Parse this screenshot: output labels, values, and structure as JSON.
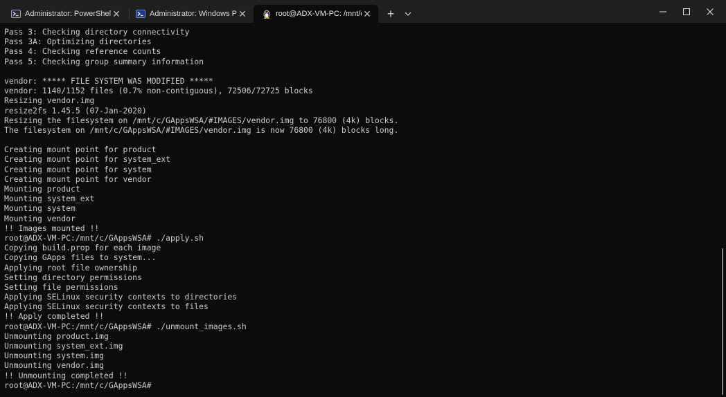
{
  "window": {
    "tabs": [
      {
        "label": "Administrator: PowerShell",
        "icon": "powershell-icon",
        "active": false
      },
      {
        "label": "Administrator: Windows PowerShell",
        "icon": "powershell-icon",
        "active": false
      },
      {
        "label": "root@ADX-VM-PC: /mnt/c/GAppsWSA",
        "icon": "linux-penguin-icon",
        "active": true
      }
    ],
    "new_tab_glyph": "+",
    "dropdown_glyph": "⌵",
    "controls": {
      "minimize": "–",
      "maximize": "☐",
      "close": "✕"
    }
  },
  "terminal": {
    "lines": [
      "Pass 3: Checking directory connectivity",
      "Pass 3A: Optimizing directories",
      "Pass 4: Checking reference counts",
      "Pass 5: Checking group summary information",
      "",
      "vendor: ***** FILE SYSTEM WAS MODIFIED *****",
      "vendor: 1140/1152 files (0.7% non-contiguous), 72506/72725 blocks",
      "Resizing vendor.img",
      "resize2fs 1.45.5 (07-Jan-2020)",
      "Resizing the filesystem on /mnt/c/GAppsWSA/#IMAGES/vendor.img to 76800 (4k) blocks.",
      "The filesystem on /mnt/c/GAppsWSA/#IMAGES/vendor.img is now 76800 (4k) blocks long.",
      "",
      "Creating mount point for product",
      "Creating mount point for system_ext",
      "Creating mount point for system",
      "Creating mount point for vendor",
      "Mounting product",
      "Mounting system_ext",
      "Mounting system",
      "Mounting vendor",
      "!! Images mounted !!",
      "root@ADX-VM-PC:/mnt/c/GAppsWSA# ./apply.sh",
      "Copying build.prop for each image",
      "Copying GApps files to system...",
      "Applying root file ownership",
      "Setting directory permissions",
      "Setting file permissions",
      "Applying SELinux security contexts to directories",
      "Applying SELinux security contexts to files",
      "!! Apply completed !!",
      "root@ADX-VM-PC:/mnt/c/GAppsWSA# ./unmount_images.sh",
      "Unmounting product.img",
      "Unmounting system_ext.img",
      "Unmounting system.img",
      "Unmounting vendor.img",
      "!! Unmounting completed !!",
      "root@ADX-VM-PC:/mnt/c/GAppsWSA# "
    ],
    "colors": {
      "background": "#0c0c0c",
      "foreground": "#cccccc",
      "titlebar": "#202020"
    }
  }
}
